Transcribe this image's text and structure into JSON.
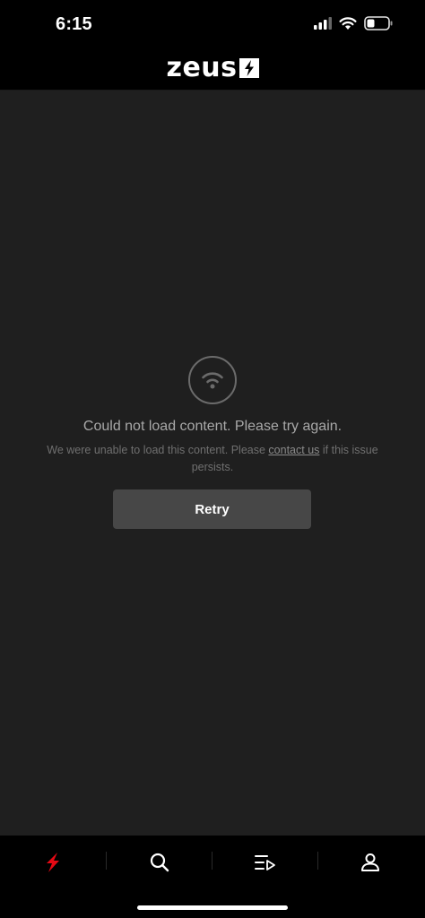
{
  "status_bar": {
    "time": "6:15",
    "icons": [
      "signal-icon",
      "wifi-icon",
      "battery-icon"
    ]
  },
  "header": {
    "logo_text": "zeus",
    "logo_icon": "bolt-icon"
  },
  "error": {
    "icon": "wifi-icon",
    "title": "Could not load content. Please try again.",
    "desc_before": "We were unable to load this content. Please ",
    "desc_link": "contact us",
    "desc_after": " if this issue persists.",
    "retry_label": "Retry"
  },
  "tab_bar": {
    "tabs": [
      {
        "name": "home",
        "icon": "bolt-icon",
        "active": true
      },
      {
        "name": "search",
        "icon": "search-icon",
        "active": false
      },
      {
        "name": "playlist",
        "icon": "playlist-icon",
        "active": false
      },
      {
        "name": "profile",
        "icon": "user-icon",
        "active": false
      }
    ]
  },
  "colors": {
    "background": "#1f1f1f",
    "bar": "#000000",
    "accent": "#e50914",
    "button": "#474747"
  }
}
